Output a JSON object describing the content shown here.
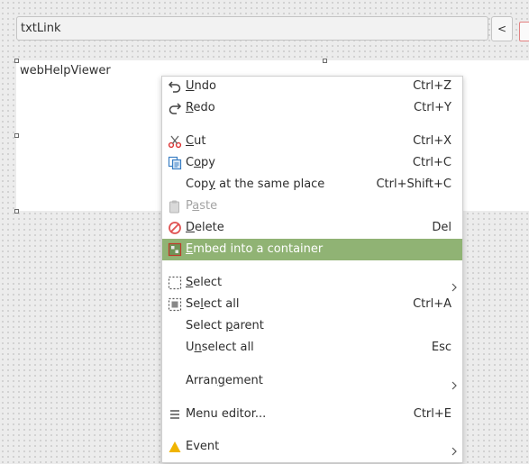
{
  "toolbar": {
    "text_field_value": "txtLink",
    "back_button_label": "<"
  },
  "viewer": {
    "label": "webHelpViewer"
  },
  "context_menu": {
    "accent_color": "#90b374",
    "items": [
      {
        "label": "Undo",
        "mnemonic": "U",
        "shortcut": "Ctrl+Z",
        "icon": "undo-icon"
      },
      {
        "label": "Redo",
        "mnemonic": "R",
        "shortcut": "Ctrl+Y",
        "icon": "redo-icon"
      },
      {
        "label": "Cut",
        "mnemonic": "C",
        "shortcut": "Ctrl+X",
        "icon": "scissors-icon"
      },
      {
        "label": "Copy",
        "mnemonic": "o",
        "shortcut": "Ctrl+C",
        "icon": "copy-icon"
      },
      {
        "label": "Copy at the same place",
        "mnemonic": "y",
        "shortcut": "Ctrl+Shift+C",
        "icon": ""
      },
      {
        "label": "Paste",
        "mnemonic": "a",
        "shortcut": "",
        "icon": "paste-icon",
        "disabled": true
      },
      {
        "label": "Delete",
        "mnemonic": "D",
        "shortcut": "Del",
        "icon": "delete-icon"
      },
      {
        "label": "Embed into a container",
        "mnemonic": "E",
        "shortcut": "",
        "icon": "embed-container-icon",
        "highlighted": true
      },
      {
        "label": "Select",
        "mnemonic": "S",
        "shortcut": "",
        "icon": "select-icon",
        "submenu": true
      },
      {
        "label": "Select all",
        "mnemonic": "l",
        "shortcut": "Ctrl+A",
        "icon": "select-all-icon"
      },
      {
        "label": "Select parent",
        "mnemonic": "p",
        "shortcut": "",
        "icon": ""
      },
      {
        "label": "Unselect all",
        "mnemonic": "n",
        "shortcut": "Esc",
        "icon": ""
      },
      {
        "label": "Arrangement",
        "mnemonic": "g",
        "shortcut": "",
        "icon": "",
        "submenu": true
      },
      {
        "label": "Menu editor...",
        "mnemonic": "",
        "shortcut": "Ctrl+E",
        "icon": "menu-editor-icon"
      },
      {
        "label": "Event",
        "mnemonic": "",
        "shortcut": "",
        "icon": "event-icon",
        "submenu": true
      }
    ]
  }
}
